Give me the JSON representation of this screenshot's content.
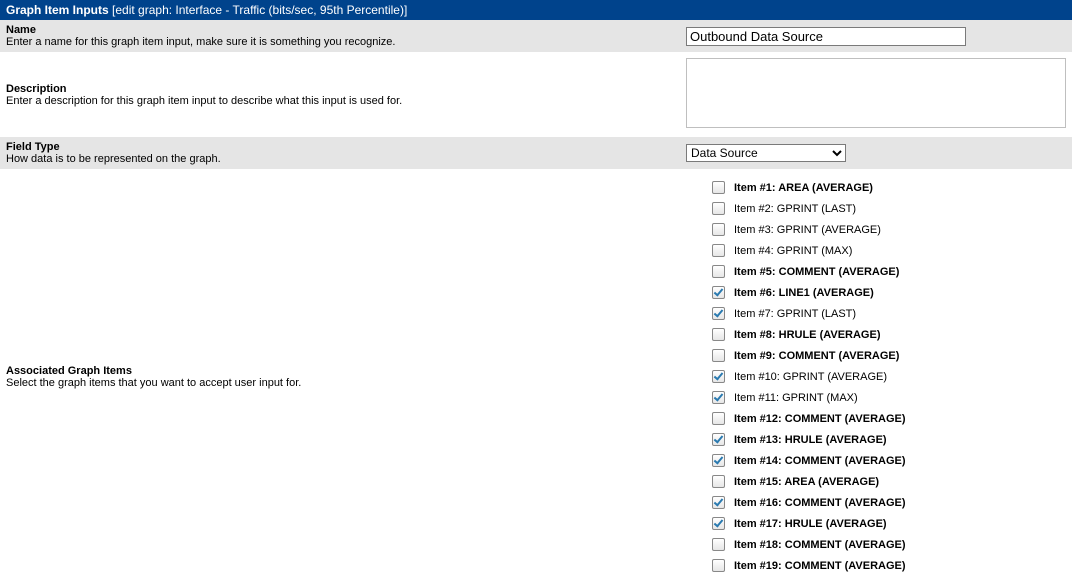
{
  "header": {
    "title": "Graph Item Inputs",
    "subtitle": "[edit graph: Interface - Traffic (bits/sec, 95th Percentile)]"
  },
  "rows": {
    "name": {
      "label": "Name",
      "desc": "Enter a name for this graph item input, make sure it is something you recognize.",
      "value": "Outbound Data Source"
    },
    "description": {
      "label": "Description",
      "desc": "Enter a description for this graph item input to describe what this input is used for.",
      "value": ""
    },
    "field_type": {
      "label": "Field Type",
      "desc": "How data is to be represented on the graph.",
      "selected": "Data Source"
    },
    "assoc": {
      "label": "Associated Graph Items",
      "desc": "Select the graph items that you want to accept user input for."
    }
  },
  "items": [
    {
      "label": "Item #1: AREA (AVERAGE)",
      "checked": false,
      "bold": true
    },
    {
      "label": "Item #2: GPRINT (LAST)",
      "checked": false,
      "bold": false
    },
    {
      "label": "Item #3: GPRINT (AVERAGE)",
      "checked": false,
      "bold": false
    },
    {
      "label": "Item #4: GPRINT (MAX)",
      "checked": false,
      "bold": false
    },
    {
      "label": "Item #5: COMMENT (AVERAGE)",
      "checked": false,
      "bold": true
    },
    {
      "label": "Item #6: LINE1 (AVERAGE)",
      "checked": true,
      "bold": true
    },
    {
      "label": "Item #7: GPRINT (LAST)",
      "checked": true,
      "bold": false
    },
    {
      "label": "Item #8: HRULE (AVERAGE)",
      "checked": false,
      "bold": true
    },
    {
      "label": "Item #9: COMMENT (AVERAGE)",
      "checked": false,
      "bold": true
    },
    {
      "label": "Item #10: GPRINT (AVERAGE)",
      "checked": true,
      "bold": false
    },
    {
      "label": "Item #11: GPRINT (MAX)",
      "checked": true,
      "bold": false
    },
    {
      "label": "Item #12: COMMENT (AVERAGE)",
      "checked": false,
      "bold": true
    },
    {
      "label": "Item #13: HRULE (AVERAGE)",
      "checked": true,
      "bold": true
    },
    {
      "label": "Item #14: COMMENT (AVERAGE)",
      "checked": true,
      "bold": true
    },
    {
      "label": "Item #15: AREA (AVERAGE)",
      "checked": false,
      "bold": true
    },
    {
      "label": "Item #16: COMMENT (AVERAGE)",
      "checked": true,
      "bold": true
    },
    {
      "label": "Item #17: HRULE (AVERAGE)",
      "checked": true,
      "bold": true
    },
    {
      "label": "Item #18: COMMENT (AVERAGE)",
      "checked": false,
      "bold": true
    },
    {
      "label": "Item #19: COMMENT (AVERAGE)",
      "checked": false,
      "bold": true
    }
  ]
}
